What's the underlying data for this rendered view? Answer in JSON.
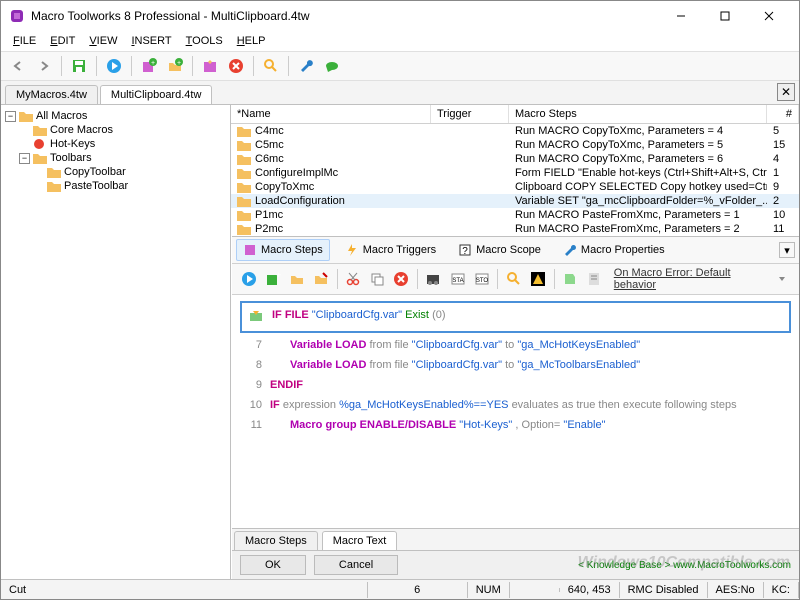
{
  "window": {
    "title": "Macro Toolworks 8    Professional - MultiClipboard.4tw"
  },
  "menu": {
    "file": "FILE",
    "edit": "EDIT",
    "view": "VIEW",
    "insert": "INSERT",
    "tools": "TOOLS",
    "help": "HELP"
  },
  "filetabs": {
    "t0": "MyMacros.4tw",
    "t1": "MultiClipboard.4tw"
  },
  "tree": {
    "all": "All Macros",
    "core": "Core Macros",
    "hot": "Hot-Keys",
    "toolbars": "Toolbars",
    "copy": "CopyToolbar",
    "paste": "PasteToolbar"
  },
  "listhdr": {
    "name": "*Name",
    "trigger": "Trigger",
    "steps": "Macro Steps",
    "num": "#"
  },
  "rows": [
    {
      "name": "C4mc",
      "trigger": "",
      "steps": "Run MACRO CopyToXmc, Parameters = 4",
      "num": "5"
    },
    {
      "name": "C5mc",
      "trigger": "",
      "steps": "Run MACRO CopyToXmc, Parameters = 5",
      "num": "15"
    },
    {
      "name": "C6mc",
      "trigger": "",
      "steps": "Run MACRO CopyToXmc, Parameters = 6",
      "num": "4"
    },
    {
      "name": "ConfigureImplMc",
      "trigger": "",
      "steps": "Form FIELD \"Enable hot-keys (Ctrl+Shift+Alt+S, Ctrl+...",
      "num": "1"
    },
    {
      "name": "CopyToXmc",
      "trigger": "",
      "steps": "Clipboard COPY SELECTED Copy hotkey used=Ctr...",
      "num": "9"
    },
    {
      "name": "LoadConfiguration",
      "trigger": "",
      "steps": "Variable SET \"ga_mcClipboardFolder=%_vFolder_...",
      "num": "2"
    },
    {
      "name": "P1mc",
      "trigger": "",
      "steps": "Run MACRO PasteFromXmc, Parameters = 1",
      "num": "10"
    },
    {
      "name": "P2mc",
      "trigger": "",
      "steps": "Run MACRO PasteFromXmc, Parameters = 2",
      "num": "11"
    }
  ],
  "steptabs": {
    "steps": "Macro Steps",
    "triggers": "Macro Triggers",
    "scope": "Macro Scope",
    "props": "Macro Properties"
  },
  "errlink": "On Macro Error: Default behavior",
  "steps": {
    "l1a": "IF FILE",
    "l1b": "\"ClipboardCfg.var\"",
    "l1c": "Exist",
    "l1d": "(0)",
    "l7n": "7",
    "l7a": "Variable LOAD",
    "l7b": "from file",
    "l7c": "\"ClipboardCfg.var\"",
    "l7d": "to",
    "l7e": "\"ga_McHotKeysEnabled\"",
    "l8n": "8",
    "l8a": "Variable LOAD",
    "l8b": "from file",
    "l8c": "\"ClipboardCfg.var\"",
    "l8d": "to",
    "l8e": "\"ga_McToolbarsEnabled\"",
    "l9n": "9",
    "l9a": "ENDIF",
    "l10n": "10",
    "l10a": "IF",
    "l10b": "expression",
    "l10c": "%ga_McHotKeysEnabled%==YES",
    "l10d": "evaluates as true then execute following steps",
    "l11n": "11",
    "l11a": "Macro group ENABLE/DISABLE",
    "l11b": "\"Hot-Keys\"",
    "l11c": ", Option=",
    "l11d": "\"Enable\""
  },
  "bottomtabs": {
    "steps": "Macro Steps",
    "text": "Macro Text"
  },
  "buttons": {
    "ok": "OK",
    "cancel": "Cancel"
  },
  "kb": "< Knowledge Base >  www.MacroToolworks.com",
  "status": {
    "cut": "Cut",
    "s6": "6",
    "num": "NUM",
    "res": "640, 453",
    "rmc": "RMC Disabled",
    "aes": "AES:No",
    "kc": "KC:"
  },
  "watermark": "Windows10Compatible.com"
}
